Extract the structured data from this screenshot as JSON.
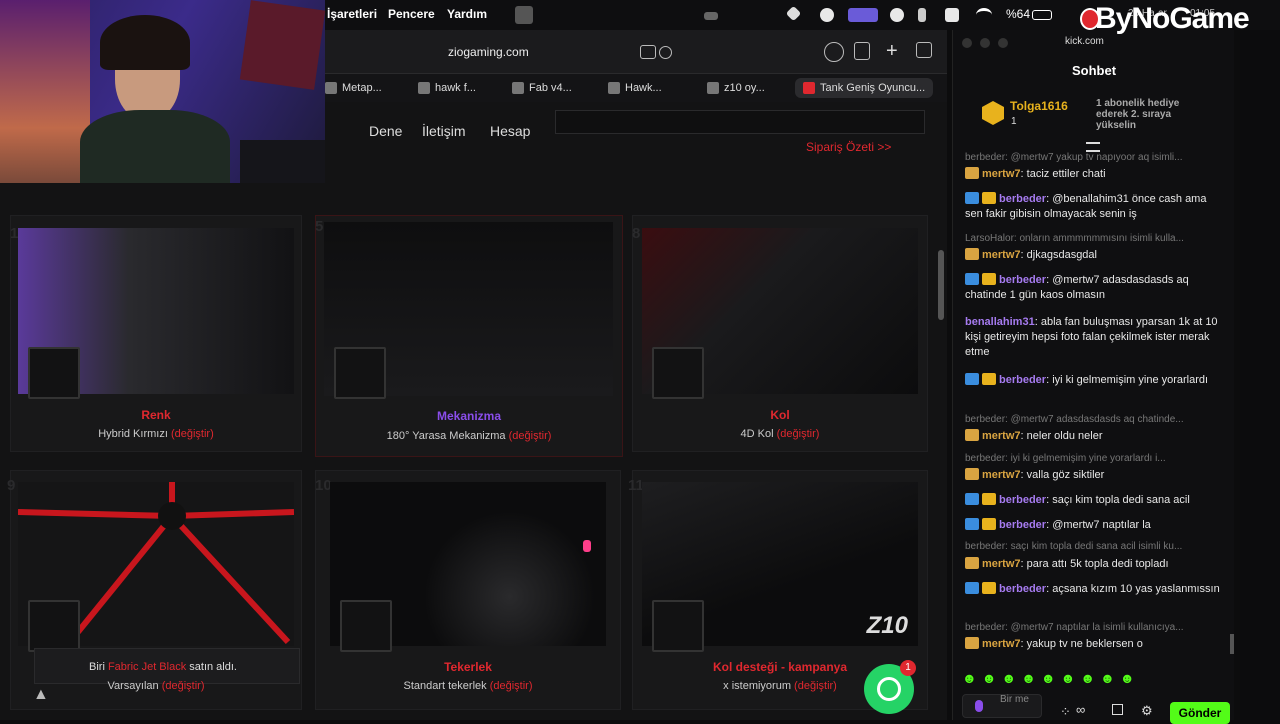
{
  "menubar": {
    "items": [
      "İşaretleri",
      "Pencere",
      "Yardım"
    ],
    "battery": "%64",
    "date": "26 Ha",
    "date2": "01:05",
    "time": "ar"
  },
  "browser": {
    "url": "ziogaming.com",
    "tabs": [
      "Metap...",
      "hawk f...",
      "Fab v4...",
      "Hawk...",
      "z10 oy...",
      "Tank Geniş Oyuncu..."
    ]
  },
  "site": {
    "nav": [
      "Dene",
      "İletişim",
      "Hesap"
    ],
    "summary_link": "Sipariş Özeti >>",
    "cards": [
      {
        "num": "1",
        "title": "Renk",
        "sub": "Hybrid Kırmızı",
        "change": "(değiştir)"
      },
      {
        "num": "5",
        "title": "Mekanizma",
        "sub": "180° Yarasa Mekanizma",
        "change": "(değiştir)"
      },
      {
        "num": "8",
        "title": "Kol",
        "sub": "4D Kol",
        "change": "(değiştir)"
      },
      {
        "num": "9",
        "title": "",
        "sub": "Varsayılan",
        "change": "(değiştir)"
      },
      {
        "num": "10",
        "title": "Tekerlek",
        "sub": "Standart tekerlek",
        "change": "(değiştir)"
      },
      {
        "num": "11",
        "title": "Kol desteği - kampanya",
        "sub": "x istemiyorum",
        "change": "(değiştir)"
      }
    ],
    "toast": {
      "prefix": "Biri",
      "product": "Fabric Jet Black",
      "suffix": "satın aldı."
    },
    "whatsapp_badge": "1",
    "img_brand": "Z10"
  },
  "watermark": "ByNoGame",
  "chat": {
    "site": "kick.com",
    "title": "Sohbet",
    "top_user": "Tolga1616",
    "top_user_count": "1",
    "pinned": "1 abonelik hediye ederek 2. sıraya yükselin",
    "messages": [
      {
        "type": "reply",
        "text": "berbeder: @mertw7 yakup tv napıyoor aq isimli..."
      },
      {
        "type": "msg",
        "user": "mertw7",
        "badge": "crown",
        "text": "taciz ettiler chati"
      },
      {
        "type": "msg",
        "user": "berbeder",
        "badge": "blue-gold",
        "text": "@benallahim31 önce cash ama sen fakir gibisin olmayacak senin iş"
      },
      {
        "type": "reply",
        "text": "LarsoHalor: onların ammmmmmısını isimli kulla..."
      },
      {
        "type": "msg",
        "user": "mertw7",
        "badge": "crown",
        "text": "djkagsdasgdal"
      },
      {
        "type": "msg",
        "user": "berbeder",
        "badge": "blue-gold",
        "text": "@mertw7 adasdasdasds aq chatinde 1 gün kaos olmasın"
      },
      {
        "type": "msg",
        "user": "benallahim31",
        "badge": "none",
        "text": "abla fan buluşması yparsan 1k at 10 kişi getireyim hepsi foto falan çekilmek ister merak etme"
      },
      {
        "type": "msg",
        "user": "berbeder",
        "badge": "blue-gold",
        "text": "iyi ki gelmemişim yine yorarlardı"
      },
      {
        "type": "reply",
        "text": "berbeder: @mertw7 adasdasdasds aq chatinde..."
      },
      {
        "type": "msg",
        "user": "mertw7",
        "badge": "crown",
        "text": "neler oldu neler"
      },
      {
        "type": "reply",
        "text": "berbeder: iyi ki gelmemişim yine yorarlardı i..."
      },
      {
        "type": "msg",
        "user": "mertw7",
        "badge": "crown",
        "text": "valla göz siktiler"
      },
      {
        "type": "msg",
        "user": "berbeder",
        "badge": "blue-gold",
        "text": "saçı kim topla dedi sana acil"
      },
      {
        "type": "msg",
        "user": "berbeder",
        "badge": "blue-gold",
        "text": "@mertw7 naptılar la"
      },
      {
        "type": "reply",
        "text": "berbeder: saçı kim topla dedi sana acil isimli ku..."
      },
      {
        "type": "msg",
        "user": "mertw7",
        "badge": "crown",
        "text": "para attı 5k topla dedi topladı"
      },
      {
        "type": "msg",
        "user": "berbeder",
        "badge": "blue-gold",
        "text": "açsana kızım 10 yas yaslanmıssın"
      },
      {
        "type": "reply",
        "text": "berbeder: @mertw7 naptılar la isimli kullanıcıya..."
      },
      {
        "type": "msg",
        "user": "mertw7",
        "badge": "crown",
        "text": "yakup tv ne beklersen o"
      }
    ],
    "input_placeholder": "Bir me",
    "send": "Gönder"
  }
}
